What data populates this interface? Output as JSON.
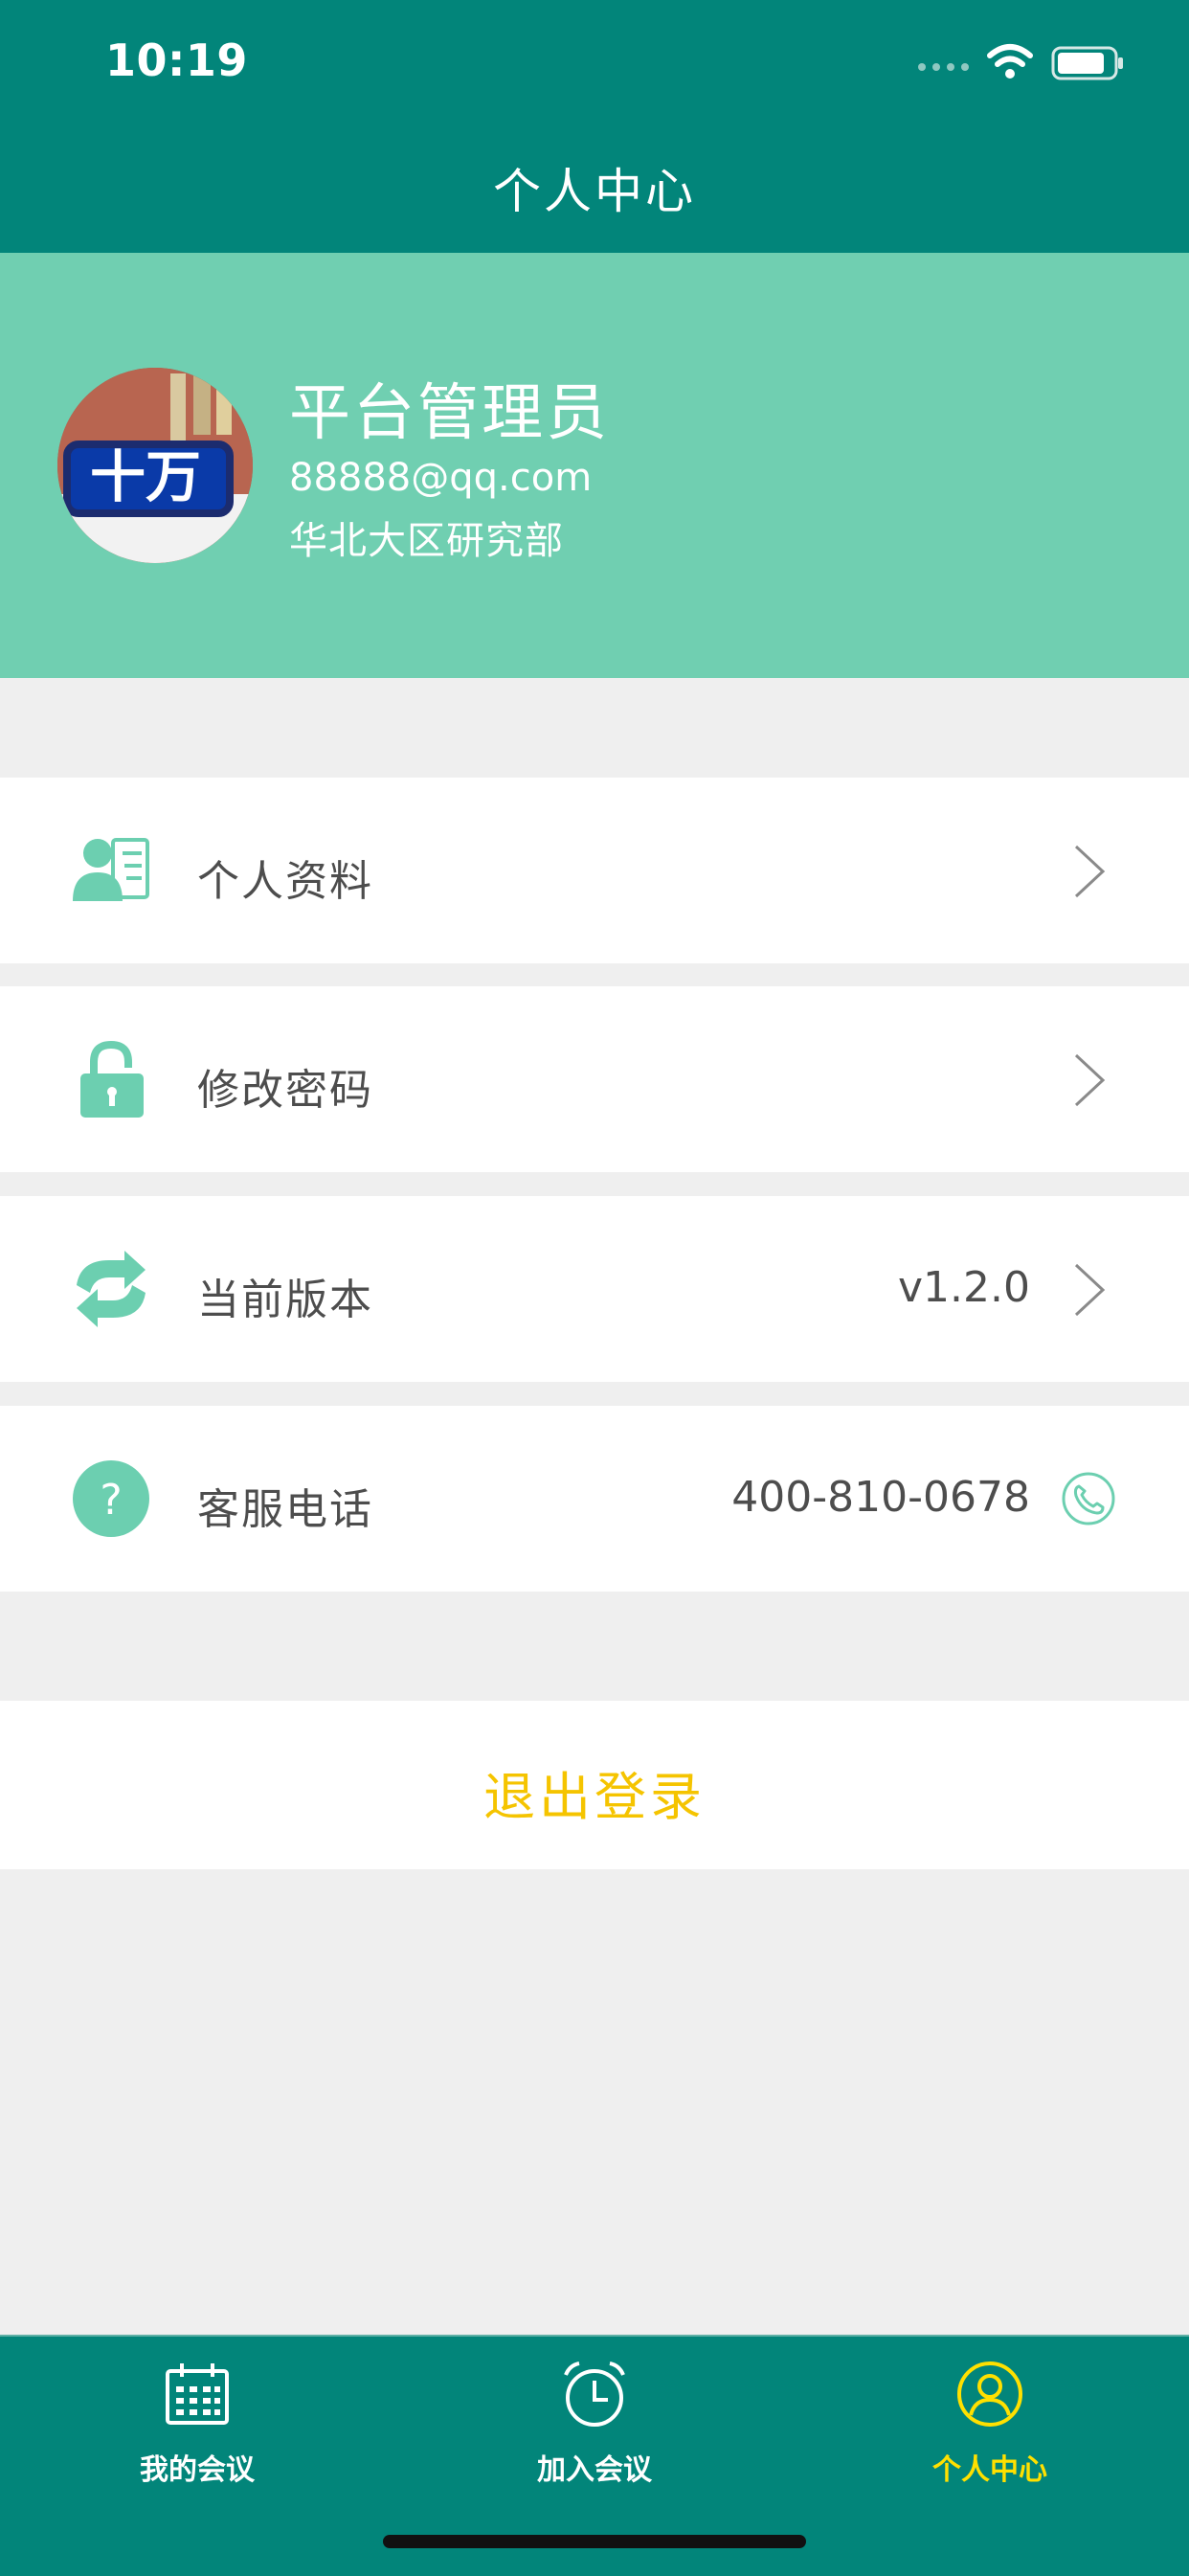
{
  "status_bar": {
    "time": "10:19"
  },
  "nav": {
    "title": "个人中心"
  },
  "profile": {
    "name": "平台管理员",
    "email": "88888@qq.com",
    "department": "华北大区研究部",
    "avatar_icon": "avatar-image",
    "avatar_text": "十万"
  },
  "menu": [
    {
      "label": "个人资料",
      "icon": "profile-card-icon",
      "value": "",
      "trailing": "chevron-right-icon"
    },
    {
      "label": "修改密码",
      "icon": "lock-icon",
      "value": "",
      "trailing": "chevron-right-icon"
    },
    {
      "label": "当前版本",
      "icon": "refresh-icon",
      "value": "v1.2.0",
      "trailing": "chevron-right-icon"
    },
    {
      "label": "客服电话",
      "icon": "help-icon",
      "value": "400-810-0678",
      "trailing": "phone-icon"
    }
  ],
  "logout": {
    "label": "退出登录"
  },
  "tabs": [
    {
      "label": "我的会议",
      "icon": "calendar-icon",
      "active": false
    },
    {
      "label": "加入会议",
      "icon": "alarm-clock-icon",
      "active": false
    },
    {
      "label": "个人中心",
      "icon": "user-circle-icon",
      "active": true
    }
  ],
  "colors": {
    "header_bg": "#02857a",
    "banner_bg": "#70cfb1",
    "accent_icon": "#6ccfb0",
    "logout_text": "#f5c400",
    "active_tab": "#ffe000"
  }
}
